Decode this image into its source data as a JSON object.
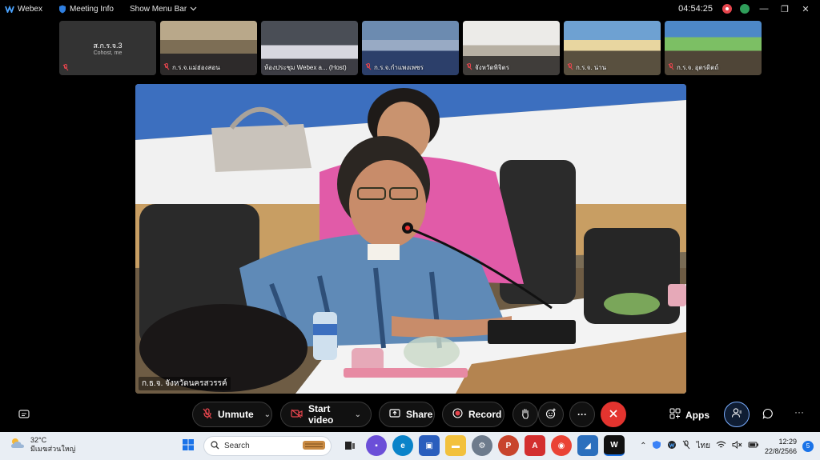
{
  "topbar": {
    "app_name": "Webex",
    "meeting_info": "Meeting Info",
    "show_menu_bar": "Show Menu Bar",
    "time": "04:54:25"
  },
  "thumbnails": [
    {
      "name": "ส.ก.ร.จ.3",
      "sub": "Cohost, me",
      "self": true
    },
    {
      "name": "ก.ร.จ.แม่ฮ่องสอน"
    },
    {
      "name": "ห้องประชุม Webex a... (Host)"
    },
    {
      "name": "ก.ร.จ.กำแพงเพชร"
    },
    {
      "name": "จังหวัดพิจิตร"
    },
    {
      "name": "ก.ร.จ. น่าน"
    },
    {
      "name": "ก.ร.จ. อุตรดิตถ์"
    }
  ],
  "main_video": {
    "label": "ก.ธ.จ. จังหวัดนครสวรรค์"
  },
  "controls": {
    "unmute": "Unmute",
    "start_video": "Start video",
    "share": "Share",
    "record": "Record",
    "apps": "Apps"
  },
  "taskbar": {
    "temp": "32°C",
    "weather_desc": "มีเมฆส่วนใหญ่",
    "search": "Search",
    "lang": "ไทย",
    "time": "12:29",
    "date": "22/8/2566",
    "notif_count": "5"
  }
}
